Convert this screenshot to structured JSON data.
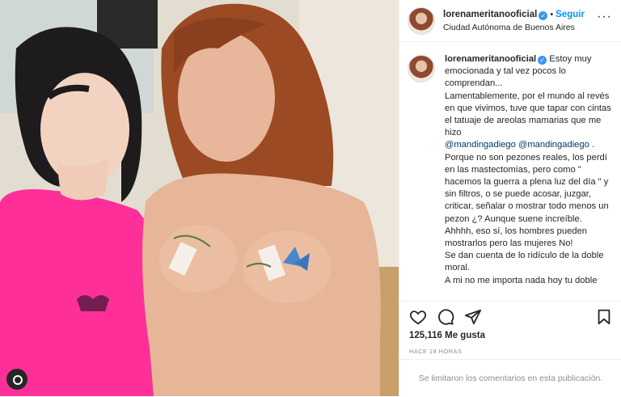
{
  "header": {
    "username": "lorenameritanooficial",
    "verified_glyph": "✓",
    "separator": "•",
    "follow_label": "Seguir",
    "location": "Ciudad Autónoma de Buenos Aires",
    "more_glyph": "···"
  },
  "caption": {
    "username": "lorenameritanooficial",
    "verified_glyph": "✓",
    "text_1": " Estoy muy emocionada y tal vez pocos lo comprendan...\nLamentablemente, por el mundo al revés en que vivimos, tuve que tapar con cintas el tatuaje de areolas mamarias que me hizo\n",
    "mention_1": "@mandingadiego",
    "space": " ",
    "mention_2": "@mandingadiego",
    "text_2": " .\nPorque no son pezones reales, los perdí en las mastectomías, pero como \" hacemos la guerra a plena luz del día \" y sin filtros, o se puede acosar, juzgar, criticar, señalar o mostrar todo menos un pezon ¿? Aunque suene increíble.\nAhhhh, eso sí, los hombres pueden mostrarlos pero las mujeres No!\nSe dan cuenta de lo ridículo de la doble moral.\nA mi no me importa nada hoy tu doble"
  },
  "actions": {
    "like_icon": "heart-icon",
    "comment_icon": "comment-icon",
    "share_icon": "paper-plane-icon",
    "save_icon": "bookmark-icon"
  },
  "likes_text": "125,116 Me gusta",
  "timestamp": "HACE 18 HORAS",
  "comments_notice": "Se limitaron los comentarios en esta publicación."
}
